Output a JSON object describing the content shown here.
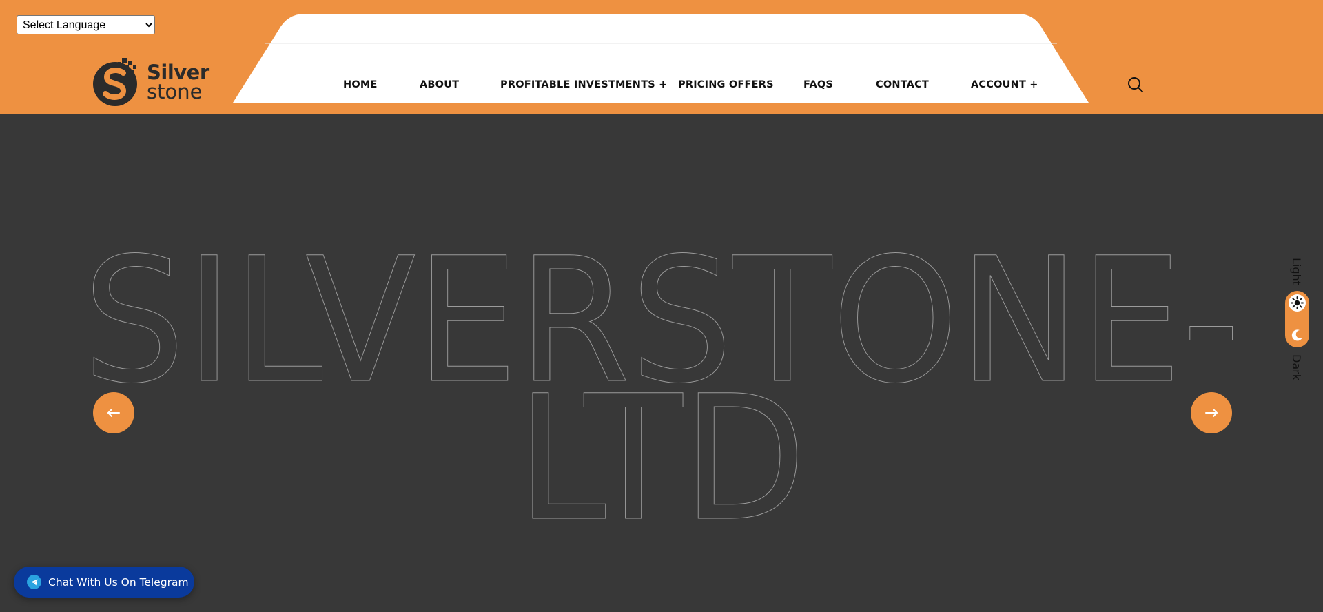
{
  "header": {
    "language_select": {
      "selected": "Select Language"
    },
    "logo": {
      "line1": "Silver",
      "line2": "stone"
    },
    "nav": [
      {
        "label": "HOME"
      },
      {
        "label": "ABOUT"
      },
      {
        "label": "PROFITABLE INVESTMENTS +"
      },
      {
        "label": "PRICING OFFERS"
      },
      {
        "label": "FAQS"
      },
      {
        "label": "CONTACT"
      },
      {
        "label": "ACCOUNT +"
      }
    ],
    "search_icon": "search-icon"
  },
  "hero": {
    "line1": "SILVERSTONE-",
    "line2": "LTD",
    "prev_icon": "arrow-left-icon",
    "next_icon": "arrow-right-icon"
  },
  "theme_switch": {
    "light_label": "Light",
    "dark_label": "Dark",
    "state": "light"
  },
  "telegram": {
    "label": "Chat With Us On Telegram",
    "icon": "telegram-icon"
  },
  "colors": {
    "accent": "#EE9141",
    "hero_background": "#383838",
    "telegram_button": "#0A3A9C"
  }
}
